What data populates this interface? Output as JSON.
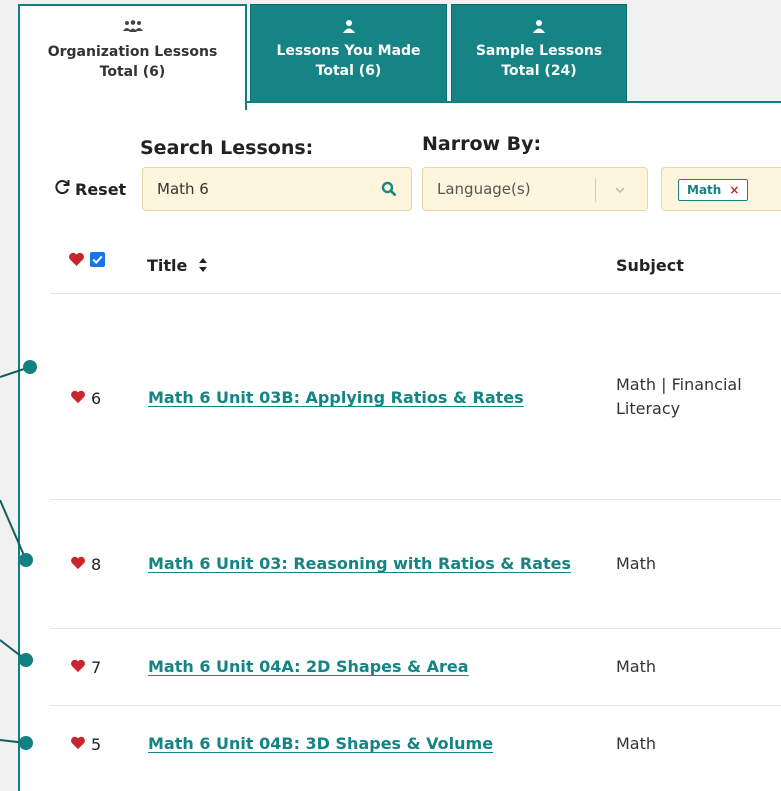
{
  "tabs": [
    {
      "title": "Organization Lessons",
      "total": "Total (6)",
      "icon": "people-icon"
    },
    {
      "title": "Lessons You Made",
      "total": "Total (6)",
      "icon": "person-icon"
    },
    {
      "title": "Sample Lessons",
      "total": "Total (24)",
      "icon": "person-icon"
    }
  ],
  "search": {
    "label": "Search Lessons:",
    "value": "Math 6"
  },
  "reset_label": "Reset",
  "narrow": {
    "label": "Narrow By:",
    "language_placeholder": "Language(s)",
    "chip": "Math",
    "chip_remove": "×"
  },
  "table": {
    "headers": {
      "title": "Title",
      "subject": "Subject"
    },
    "rows": [
      {
        "favorites": "6",
        "title": "Math 6 Unit 03B: Applying Ratios & Rates",
        "subject_line1": "Math | Financial",
        "subject_line2": "Literacy"
      },
      {
        "favorites": "8",
        "title": "Math 6 Unit 03: Reasoning with Ratios & Rates",
        "subject_line1": "Math",
        "subject_line2": ""
      },
      {
        "favorites": "7",
        "title": "Math 6 Unit 04A: 2D Shapes & Area",
        "subject_line1": "Math",
        "subject_line2": ""
      },
      {
        "favorites": "5",
        "title": "Math 6 Unit 04B: 3D Shapes & Volume",
        "subject_line1": "Math",
        "subject_line2": ""
      }
    ]
  },
  "colors": {
    "teal": "#168384",
    "heart": "#c8262f",
    "input_bg": "#fdf6dc"
  }
}
